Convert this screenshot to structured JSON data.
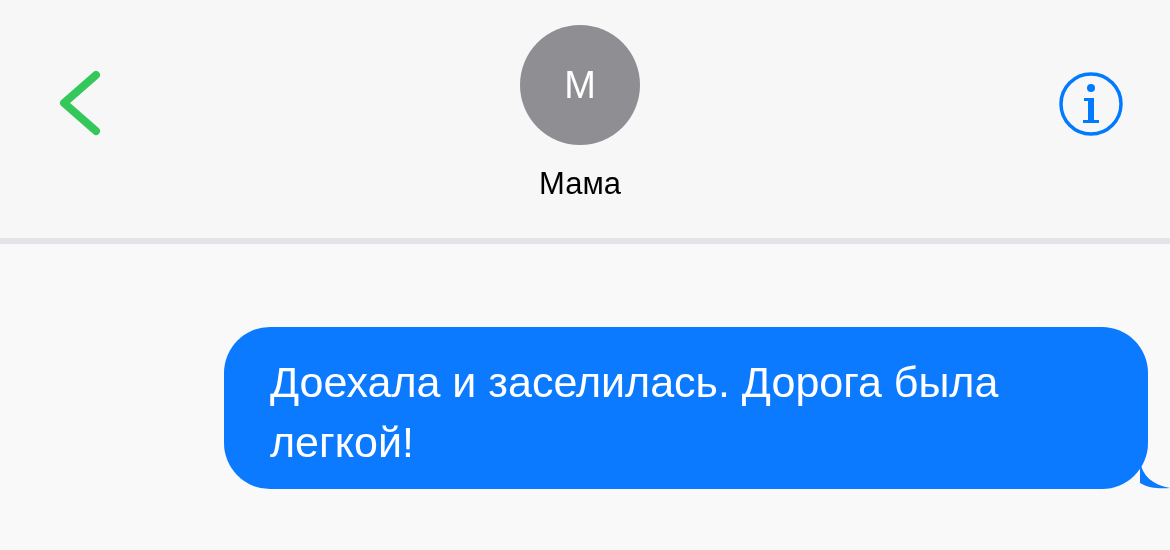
{
  "header": {
    "avatar_initial": "M",
    "contact_name": "Мама"
  },
  "messages": [
    {
      "kind": "outgoing",
      "text": "Доехала и заселилась. Дорога была легкой!"
    }
  ]
}
